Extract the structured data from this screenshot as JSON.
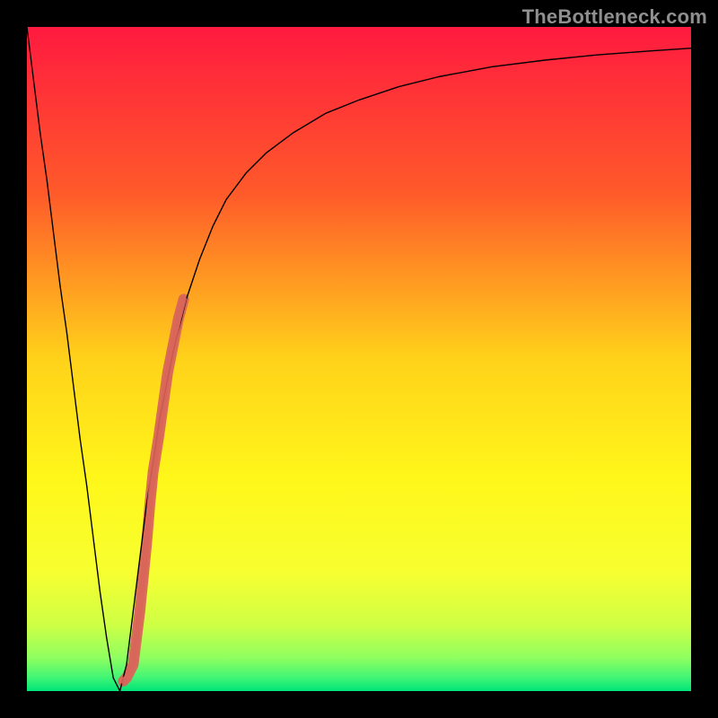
{
  "watermark": "TheBottleneck.com",
  "chart_data": {
    "type": "line",
    "title": "",
    "xlabel": "",
    "ylabel": "",
    "xlim": [
      0,
      100
    ],
    "ylim": [
      0,
      100
    ],
    "background": {
      "stops": [
        {
          "pos": 0.0,
          "color": "#ff1a3f"
        },
        {
          "pos": 0.25,
          "color": "#ff5a2a"
        },
        {
          "pos": 0.5,
          "color": "#ffd21a"
        },
        {
          "pos": 0.68,
          "color": "#fff71a"
        },
        {
          "pos": 0.82,
          "color": "#f7ff30"
        },
        {
          "pos": 0.9,
          "color": "#cfff45"
        },
        {
          "pos": 0.95,
          "color": "#8fff60"
        },
        {
          "pos": 0.98,
          "color": "#40f575"
        },
        {
          "pos": 1.0,
          "color": "#00e37a"
        }
      ]
    },
    "series": [
      {
        "name": "bottleneck-curve",
        "color": "#000000",
        "width": 1.4,
        "x": [
          0,
          1,
          2,
          3,
          4,
          5,
          6,
          7,
          8,
          9,
          10,
          11,
          12,
          13,
          14,
          15,
          16,
          17,
          18,
          20,
          22,
          24,
          26,
          28,
          30,
          33,
          36,
          40,
          45,
          50,
          56,
          62,
          70,
          78,
          86,
          94,
          100
        ],
        "y": [
          100,
          92,
          84,
          77,
          69,
          61,
          54,
          46,
          38,
          31,
          23,
          15,
          8,
          2,
          0,
          4,
          12,
          20,
          28,
          41,
          51,
          59,
          65,
          70,
          74,
          78,
          81,
          84,
          87,
          89,
          91,
          92.5,
          94,
          95,
          95.8,
          96.4,
          96.8
        ]
      }
    ],
    "highlight_segment": {
      "name": "highlighted-range",
      "color": "#d9655a",
      "width": 12,
      "x": [
        14.5,
        15.0,
        16.0,
        17.0,
        18.0,
        18.5,
        19.0,
        19.8,
        20.5,
        21.2,
        22.0,
        22.8,
        23.6
      ],
      "y": [
        1.5,
        2.0,
        4.0,
        12.0,
        22.0,
        28.0,
        33.0,
        38.0,
        43.0,
        48.0,
        52.0,
        56.0,
        59.0
      ]
    }
  }
}
